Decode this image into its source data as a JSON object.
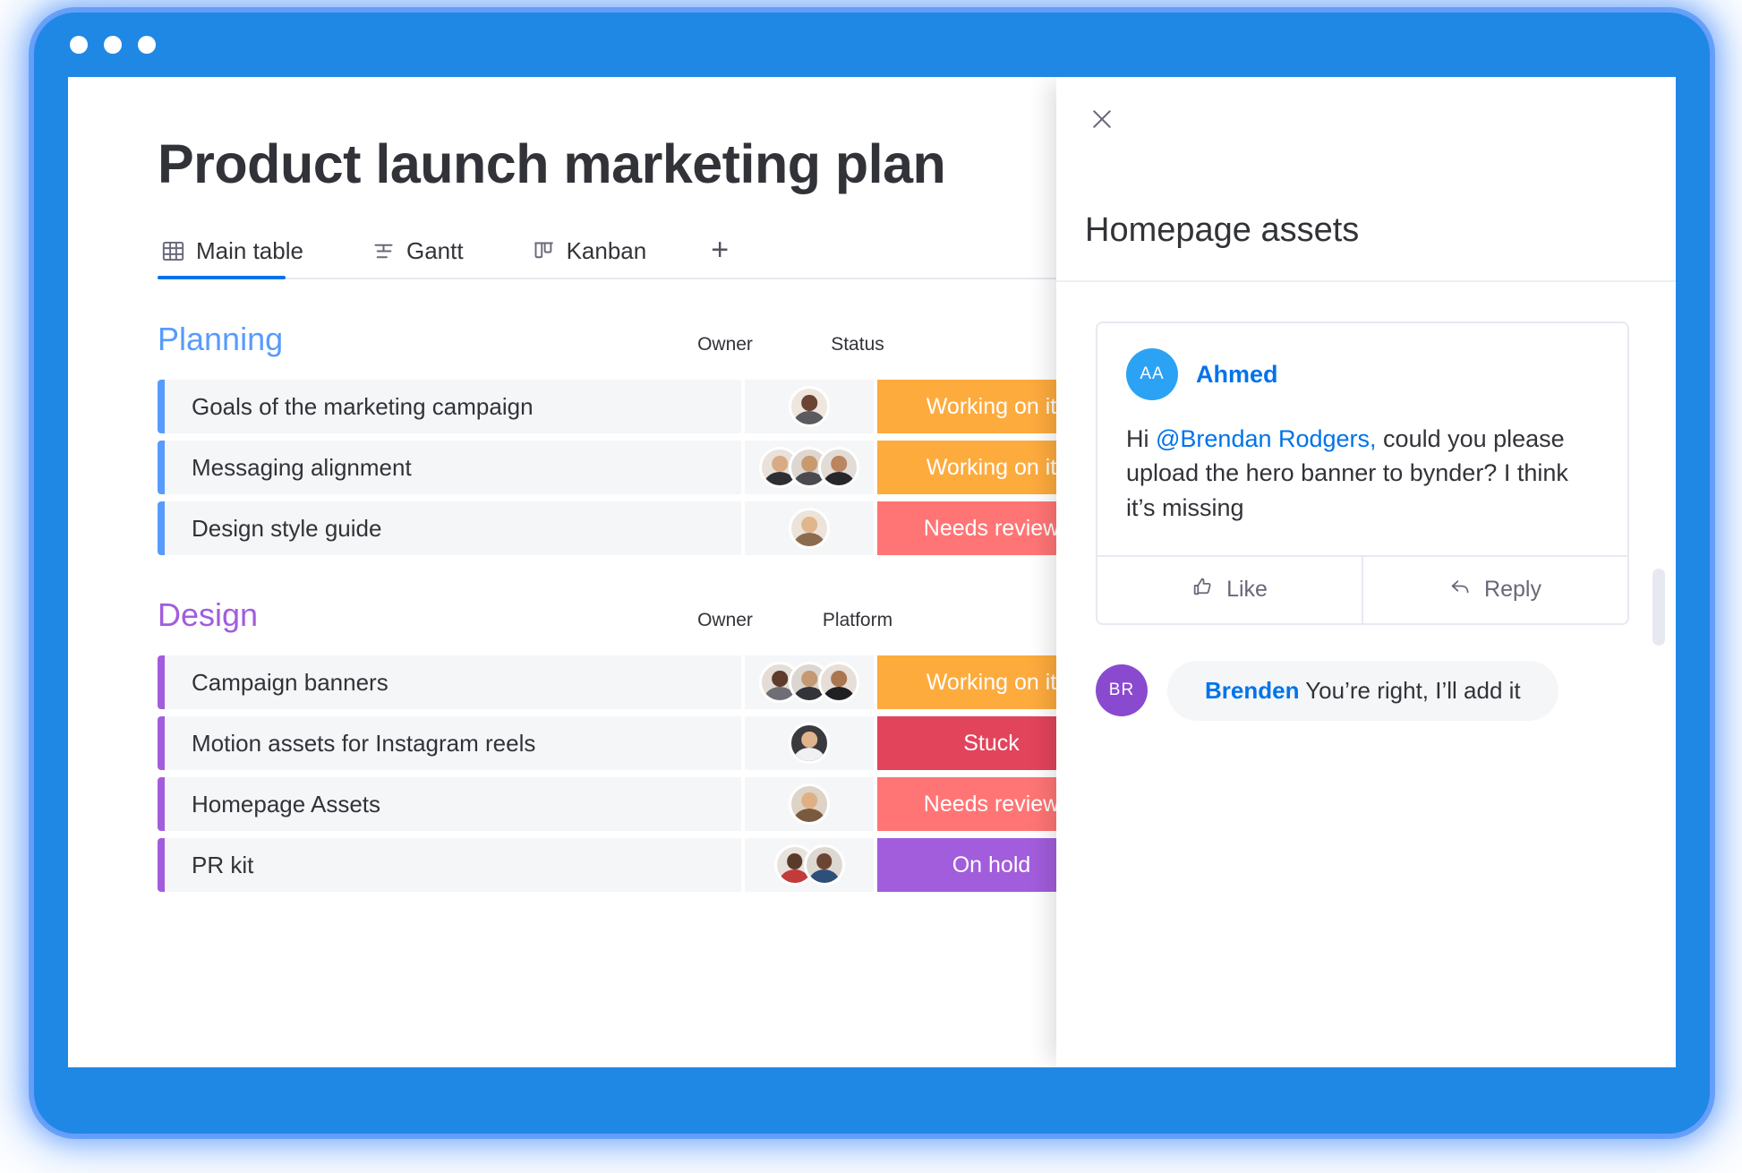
{
  "window": {
    "dots": [
      "dot-1",
      "dot-2",
      "dot-3"
    ]
  },
  "board": {
    "title": "Product launch marketing plan",
    "tabs": [
      {
        "label": "Main table",
        "icon": "table-icon",
        "active": true
      },
      {
        "label": "Gantt",
        "icon": "gantt-icon",
        "active": false
      },
      {
        "label": "Kanban",
        "icon": "kanban-icon",
        "active": false
      }
    ],
    "add_tab_label": "+",
    "groups": [
      {
        "name": "Planning",
        "color": "#579BFC",
        "columns": [
          "Owner",
          "Status"
        ],
        "rows": [
          {
            "name": "Goals of the marketing campaign",
            "status": "Working on it",
            "status_color": "#FDAB3D",
            "owners": 1
          },
          {
            "name": "Messaging alignment",
            "status": "Working on it",
            "status_color": "#FDAB3D",
            "owners": 3
          },
          {
            "name": "Design style guide",
            "status": "Needs review",
            "status_color": "#FF7575",
            "owners": 1
          }
        ]
      },
      {
        "name": "Design",
        "color": "#A25DDC",
        "columns": [
          "Owner",
          "Platform"
        ],
        "rows": [
          {
            "name": "Campaign banners",
            "status": "Working on it",
            "status_color": "#FDAB3D",
            "owners": 3
          },
          {
            "name": "Motion assets for Instagram reels",
            "status": "Stuck",
            "status_color": "#E2445C",
            "owners": 1
          },
          {
            "name": "Homepage Assets",
            "status": "Needs review",
            "status_color": "#FF7575",
            "owners": 1
          },
          {
            "name": "PR kit",
            "status": "On hold",
            "status_color": "#A25DDC",
            "owners": 2
          }
        ]
      }
    ]
  },
  "panel": {
    "close_label": "×",
    "title": "Homepage assets",
    "comment": {
      "author_initials": "AA",
      "author_name": "Ahmed",
      "avatar_color": "#2CA2F5",
      "text_before": "Hi ",
      "mention": "@Brendan Rodgers,",
      "text_after": " could you please upload the hero banner to bynder? I think it’s missing",
      "actions": [
        {
          "label": "Like",
          "icon": "thumbs-up-icon"
        },
        {
          "label": "Reply",
          "icon": "reply-arrow-icon"
        }
      ]
    },
    "reply": {
      "author_initials": "BR",
      "avatar_color": "#8A4AD0",
      "author_name": "Brenden",
      "text": " You’re right, I’ll add it"
    }
  },
  "theme": {
    "frame_blue": "#1F88E5",
    "accent_blue": "#0073EA",
    "text_dark": "#323338",
    "text_muted": "#676879",
    "row_bg": "#F5F6F8"
  }
}
